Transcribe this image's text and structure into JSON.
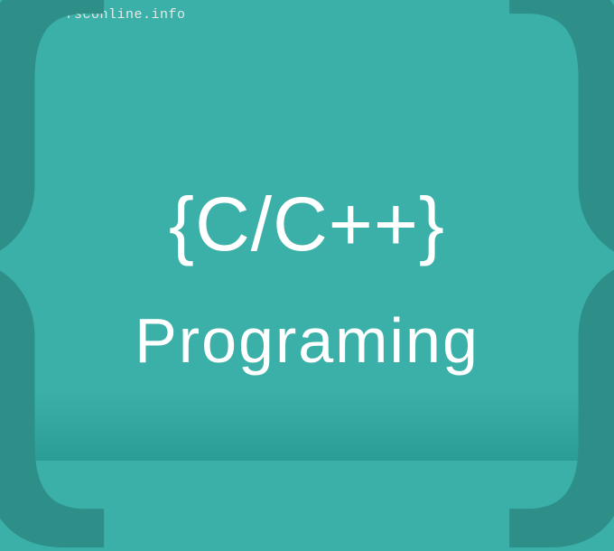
{
  "url": "http://fsconline.info",
  "braces": {
    "left": "{",
    "right": "}"
  },
  "title": "{C/C++}",
  "subtitle": "Programing"
}
